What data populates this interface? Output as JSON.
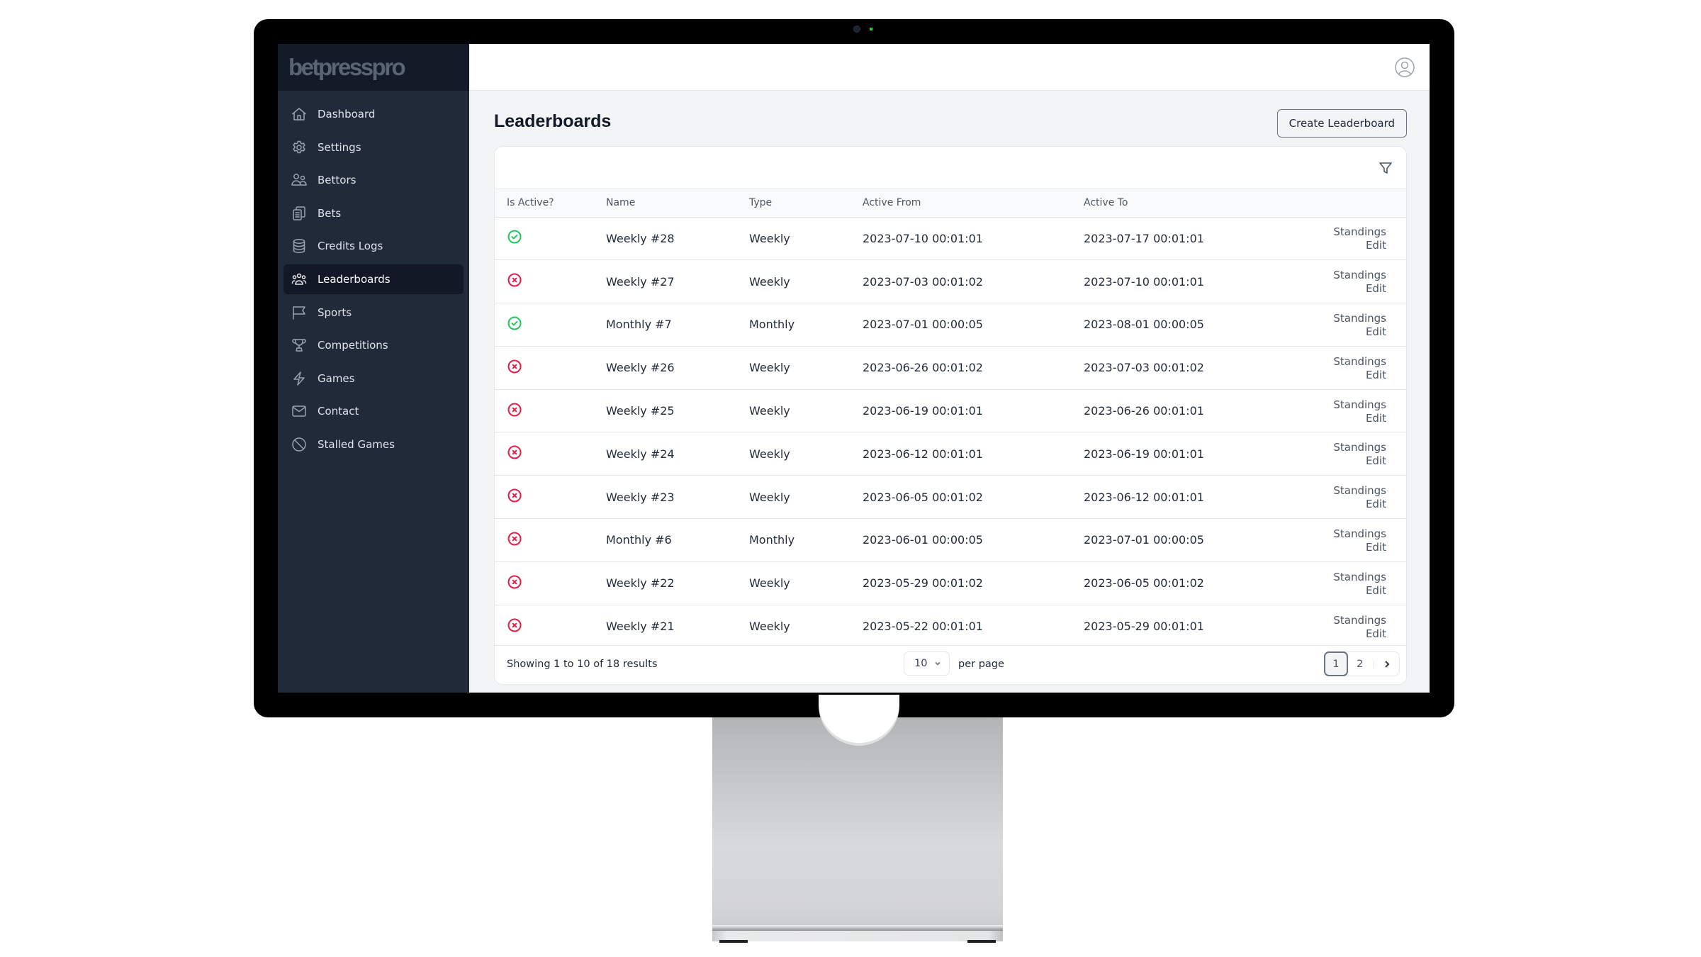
{
  "device": {
    "type": "desktop-monitor"
  },
  "sidebar": {
    "logo": "betpresspro",
    "items": [
      {
        "label": "Dashboard",
        "icon": "home-icon",
        "active": false
      },
      {
        "label": "Settings",
        "icon": "gear-icon",
        "active": false
      },
      {
        "label": "Bettors",
        "icon": "users-icon",
        "active": false
      },
      {
        "label": "Bets",
        "icon": "clipboard-icon",
        "active": false
      },
      {
        "label": "Credits Logs",
        "icon": "database-icon",
        "active": false
      },
      {
        "label": "Leaderboards",
        "icon": "user-group-icon",
        "active": true
      },
      {
        "label": "Sports",
        "icon": "flag-icon",
        "active": false
      },
      {
        "label": "Competitions",
        "icon": "trophy-icon",
        "active": false
      },
      {
        "label": "Games",
        "icon": "bolt-icon",
        "active": false
      },
      {
        "label": "Contact",
        "icon": "envelope-icon",
        "active": false
      },
      {
        "label": "Stalled Games",
        "icon": "no-symbol-icon",
        "active": false
      }
    ]
  },
  "topbar": {
    "user_icon": "user-circle-icon"
  },
  "page": {
    "title": "Leaderboards",
    "create_button": "Create Leaderboard",
    "filter_icon": "funnel-icon"
  },
  "table": {
    "columns": [
      "Is Active?",
      "Name",
      "Type",
      "Active From",
      "Active To",
      ""
    ],
    "rows": [
      {
        "active": true,
        "name": "Weekly #28",
        "type": "Weekly",
        "from": "2023-07-10 00:01:01",
        "to": "2023-07-17 00:01:01",
        "actions": [
          "Standings",
          "Edit"
        ]
      },
      {
        "active": false,
        "name": "Weekly #27",
        "type": "Weekly",
        "from": "2023-07-03 00:01:02",
        "to": "2023-07-10 00:01:01",
        "actions": [
          "Standings",
          "Edit"
        ]
      },
      {
        "active": true,
        "name": "Monthly #7",
        "type": "Monthly",
        "from": "2023-07-01 00:00:05",
        "to": "2023-08-01 00:00:05",
        "actions": [
          "Standings",
          "Edit"
        ]
      },
      {
        "active": false,
        "name": "Weekly #26",
        "type": "Weekly",
        "from": "2023-06-26 00:01:02",
        "to": "2023-07-03 00:01:02",
        "actions": [
          "Standings",
          "Edit"
        ]
      },
      {
        "active": false,
        "name": "Weekly #25",
        "type": "Weekly",
        "from": "2023-06-19 00:01:01",
        "to": "2023-06-26 00:01:01",
        "actions": [
          "Standings",
          "Edit"
        ]
      },
      {
        "active": false,
        "name": "Weekly #24",
        "type": "Weekly",
        "from": "2023-06-12 00:01:01",
        "to": "2023-06-19 00:01:01",
        "actions": [
          "Standings",
          "Edit"
        ]
      },
      {
        "active": false,
        "name": "Weekly #23",
        "type": "Weekly",
        "from": "2023-06-05 00:01:02",
        "to": "2023-06-12 00:01:01",
        "actions": [
          "Standings",
          "Edit"
        ]
      },
      {
        "active": false,
        "name": "Monthly #6",
        "type": "Monthly",
        "from": "2023-06-01 00:00:05",
        "to": "2023-07-01 00:00:05",
        "actions": [
          "Standings",
          "Edit"
        ]
      },
      {
        "active": false,
        "name": "Weekly #22",
        "type": "Weekly",
        "from": "2023-05-29 00:01:02",
        "to": "2023-06-05 00:01:02",
        "actions": [
          "Standings",
          "Edit"
        ]
      },
      {
        "active": false,
        "name": "Weekly #21",
        "type": "Weekly",
        "from": "2023-05-22 00:01:01",
        "to": "2023-05-29 00:01:01",
        "actions": [
          "Standings",
          "Edit"
        ]
      }
    ]
  },
  "footer": {
    "results_text": "Showing 1 to 10 of 18 results",
    "per_page_value": "10",
    "per_page_label": "per page",
    "pages": [
      "1",
      "2"
    ],
    "current_page": "1"
  },
  "colors": {
    "sidebar_bg": "#212a38",
    "sidebar_active": "#121826",
    "active_status": "#22c55e",
    "inactive_status": "#e11d48"
  }
}
